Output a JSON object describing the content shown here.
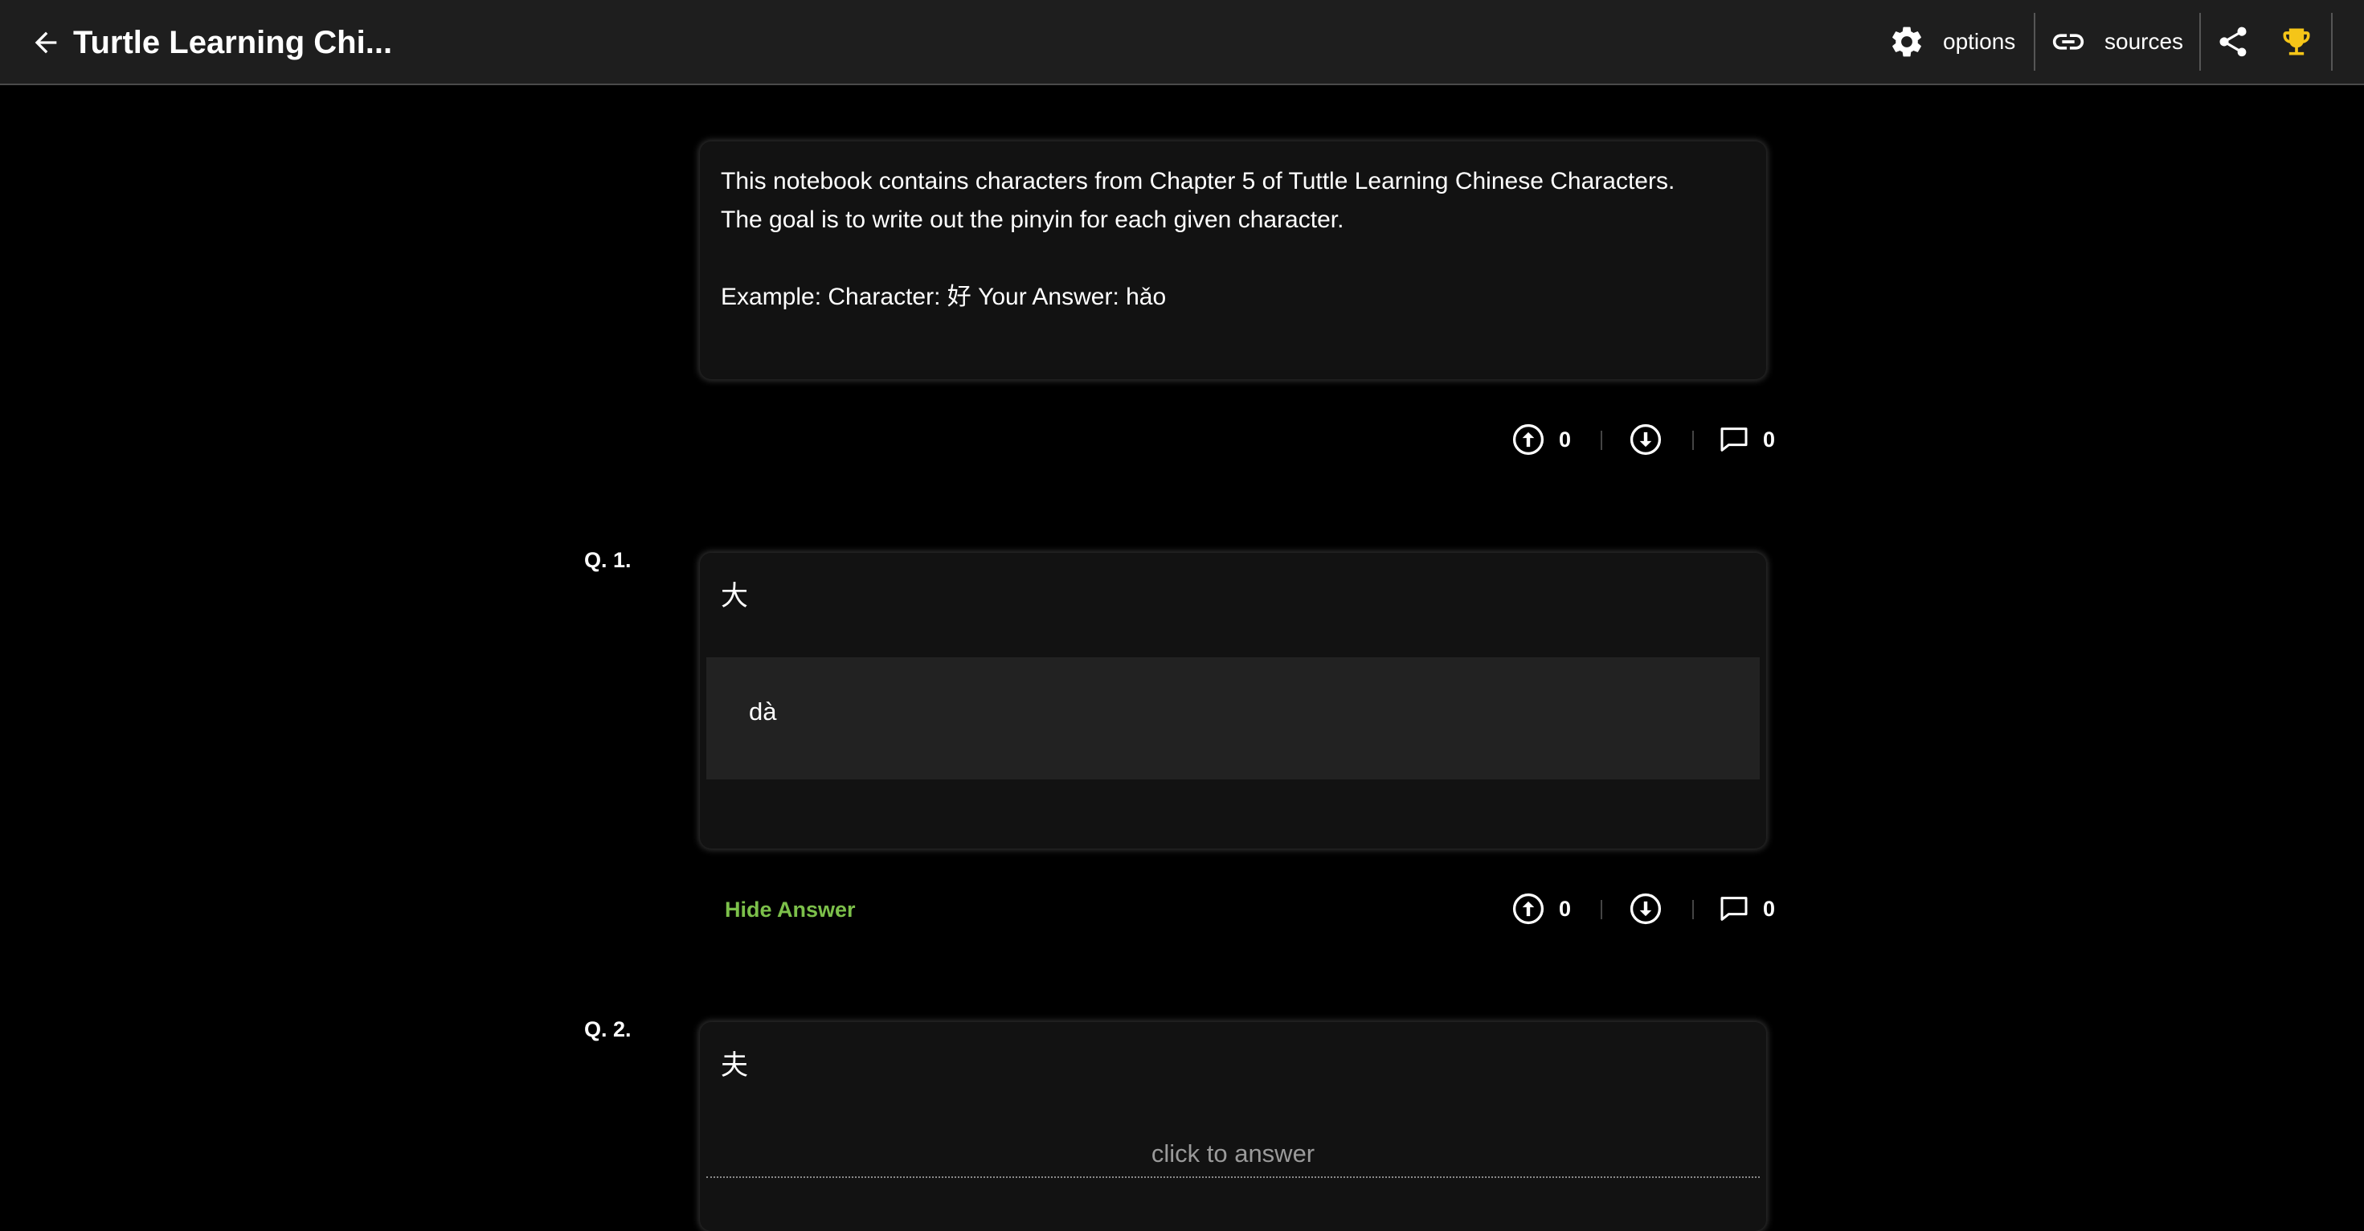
{
  "header": {
    "title": "Turtle Learning Chi...",
    "options_label": "options",
    "sources_label": "sources"
  },
  "colors": {
    "accent_green": "#7cc04a",
    "trophy_yellow": "#f5c518",
    "background": "#000000",
    "card": "#121212"
  },
  "intro": {
    "line1": "This notebook contains characters from Chapter 5 of Tuttle Learning Chinese Characters.",
    "line2": "The goal is to write out the pinyin for each given character.",
    "example": "Example: Character: 好 Your Answer: hǎo",
    "upvotes": "0",
    "comments": "0"
  },
  "questions": [
    {
      "label": "Q. 1.",
      "character": "大",
      "answer": "dà",
      "hide_answer_label": "Hide Answer",
      "upvotes": "0",
      "comments": "0"
    },
    {
      "label": "Q. 2.",
      "character": "夫",
      "click_to_answer": "click to answer"
    }
  ]
}
